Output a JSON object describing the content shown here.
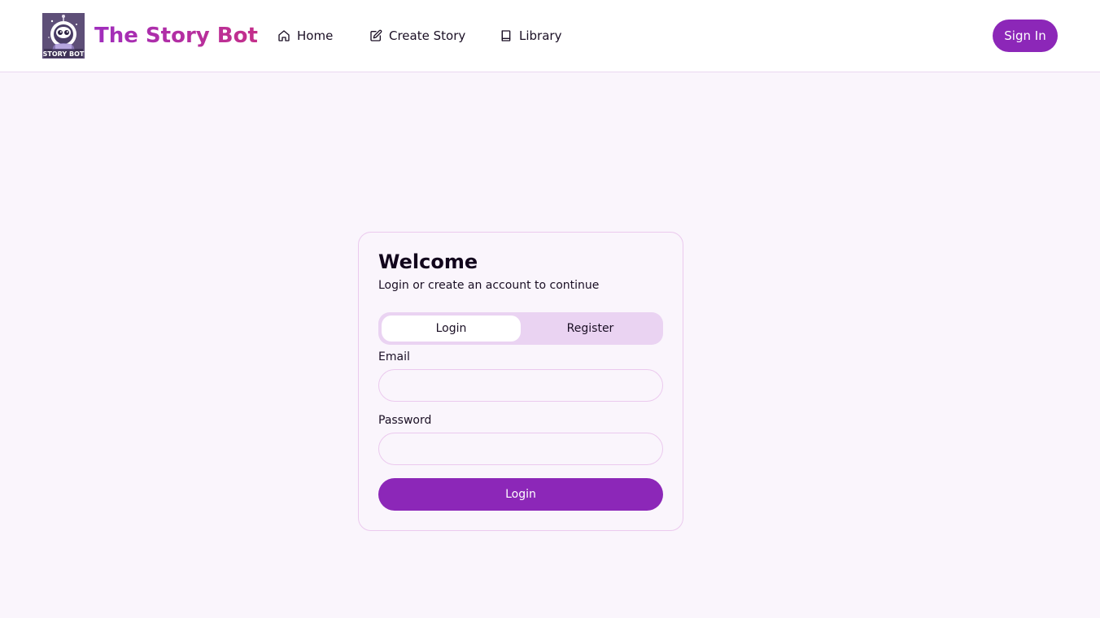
{
  "header": {
    "brand": "The Story Bot",
    "logo_text": "STORY BOT",
    "nav": [
      {
        "label": "Home",
        "icon": "home-icon"
      },
      {
        "label": "Create Story",
        "icon": "edit-icon"
      },
      {
        "label": "Library",
        "icon": "book-icon"
      }
    ],
    "sign_in_label": "Sign In"
  },
  "auth_card": {
    "title": "Welcome",
    "subtitle": "Login or create an account to continue",
    "tabs": [
      {
        "label": "Login",
        "active": true
      },
      {
        "label": "Register",
        "active": false
      }
    ],
    "email_label": "Email",
    "email_value": "",
    "password_label": "Password",
    "password_value": "",
    "submit_label": "Login"
  },
  "colors": {
    "primary": "#8c27b8",
    "brand_gradient_start": "#a02ebd",
    "brand_gradient_end": "#c42f8a",
    "page_background": "#faf5fc",
    "tab_background": "#ead3f2",
    "border": "#ebc9ee"
  }
}
